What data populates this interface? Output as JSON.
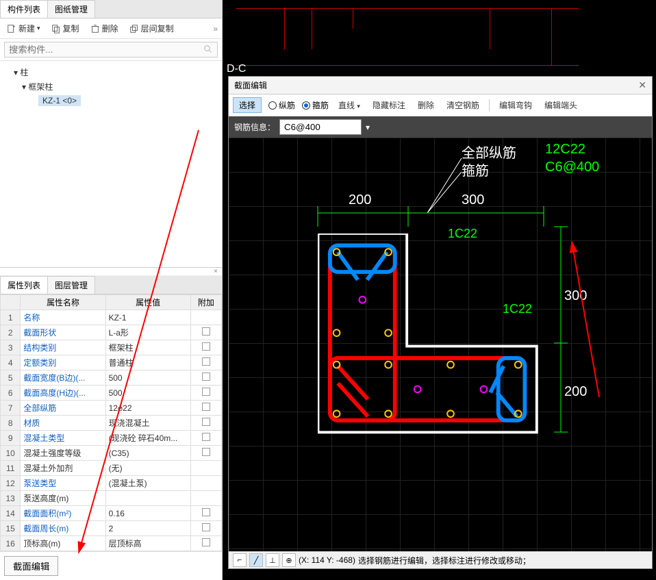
{
  "leftPanel": {
    "tabs": {
      "components": "构件列表",
      "drawings": "图纸管理"
    },
    "toolbar": {
      "new": "新建",
      "copy": "复制",
      "delete": "删除",
      "layerCopy": "层间复制",
      "chev": "»"
    },
    "search": {
      "placeholder": "搜索构件..."
    },
    "tree": {
      "root": "柱",
      "child": "框架柱",
      "leaf": "KZ-1  <0>",
      "caret": "▾"
    }
  },
  "propPanel": {
    "tabs": {
      "props": "属性列表",
      "layers": "图层管理"
    },
    "headers": {
      "name": "属性名称",
      "value": "属性值",
      "add": "附加"
    },
    "rows": [
      {
        "n": "1",
        "name": "名称",
        "value": "KZ-1",
        "blue": true,
        "chk": false
      },
      {
        "n": "2",
        "name": "截面形状",
        "value": "L-a形",
        "blue": true,
        "chk": true
      },
      {
        "n": "3",
        "name": "结构类别",
        "value": "框架柱",
        "blue": true,
        "chk": true
      },
      {
        "n": "4",
        "name": "定额类别",
        "value": "普通柱",
        "blue": true,
        "chk": true
      },
      {
        "n": "5",
        "name": "截面宽度(B边)(...",
        "value": "500",
        "blue": true,
        "chk": true
      },
      {
        "n": "6",
        "name": "截面高度(H边)(...",
        "value": "500",
        "blue": true,
        "chk": true
      },
      {
        "n": "7",
        "name": "全部纵筋",
        "value": "12⌀22",
        "blue": true,
        "chk": true
      },
      {
        "n": "8",
        "name": "材质",
        "value": "现浇混凝土",
        "blue": true,
        "chk": true
      },
      {
        "n": "9",
        "name": "混凝土类型",
        "value": "(现浇砼 碎石40m...",
        "blue": true,
        "chk": true
      },
      {
        "n": "10",
        "name": "混凝土强度等级",
        "value": "(C35)",
        "blue": false,
        "chk": true
      },
      {
        "n": "11",
        "name": "混凝土外加剂",
        "value": "(无)",
        "blue": false,
        "chk": false
      },
      {
        "n": "12",
        "name": "泵送类型",
        "value": "(混凝土泵)",
        "blue": true,
        "chk": false
      },
      {
        "n": "13",
        "name": "泵送高度(m)",
        "value": "",
        "blue": false,
        "chk": false
      },
      {
        "n": "14",
        "name": "截面面积(m²)",
        "value": "0.16",
        "blue": true,
        "chk": true
      },
      {
        "n": "15",
        "name": "截面周长(m)",
        "value": "2",
        "blue": true,
        "chk": true
      },
      {
        "n": "16",
        "name": "顶标高(m)",
        "value": "层顶标高",
        "blue": false,
        "chk": true
      }
    ],
    "editBtn": "截面编辑"
  },
  "canvas": {
    "label": "D-C"
  },
  "modal": {
    "title": "截面编辑",
    "toolbar": {
      "select": "选择",
      "long": "纵筋",
      "stirrup": "箍筋",
      "line": "直线",
      "hide": "隐藏标注",
      "delete": "删除",
      "clear": "清空钢筋",
      "editHook": "编辑弯钩",
      "editEnd": "编辑端头",
      "dd": "▾"
    },
    "info": {
      "label": "钢筋信息：",
      "value": "C6@400",
      "dd": "▾"
    },
    "annotations": {
      "allLong": "全部纵筋",
      "stirrup": "箍筋",
      "val1": "12C22",
      "val2": "C6@400",
      "d200a": "200",
      "d300a": "300",
      "d300b": "300",
      "d200b": "200",
      "g1": "1C22",
      "g2": "1C22"
    },
    "status": {
      "coords": "(X: 114 Y: -468)",
      "msg": "选择钢筋进行编辑，选择标注进行修改或移动；"
    }
  }
}
